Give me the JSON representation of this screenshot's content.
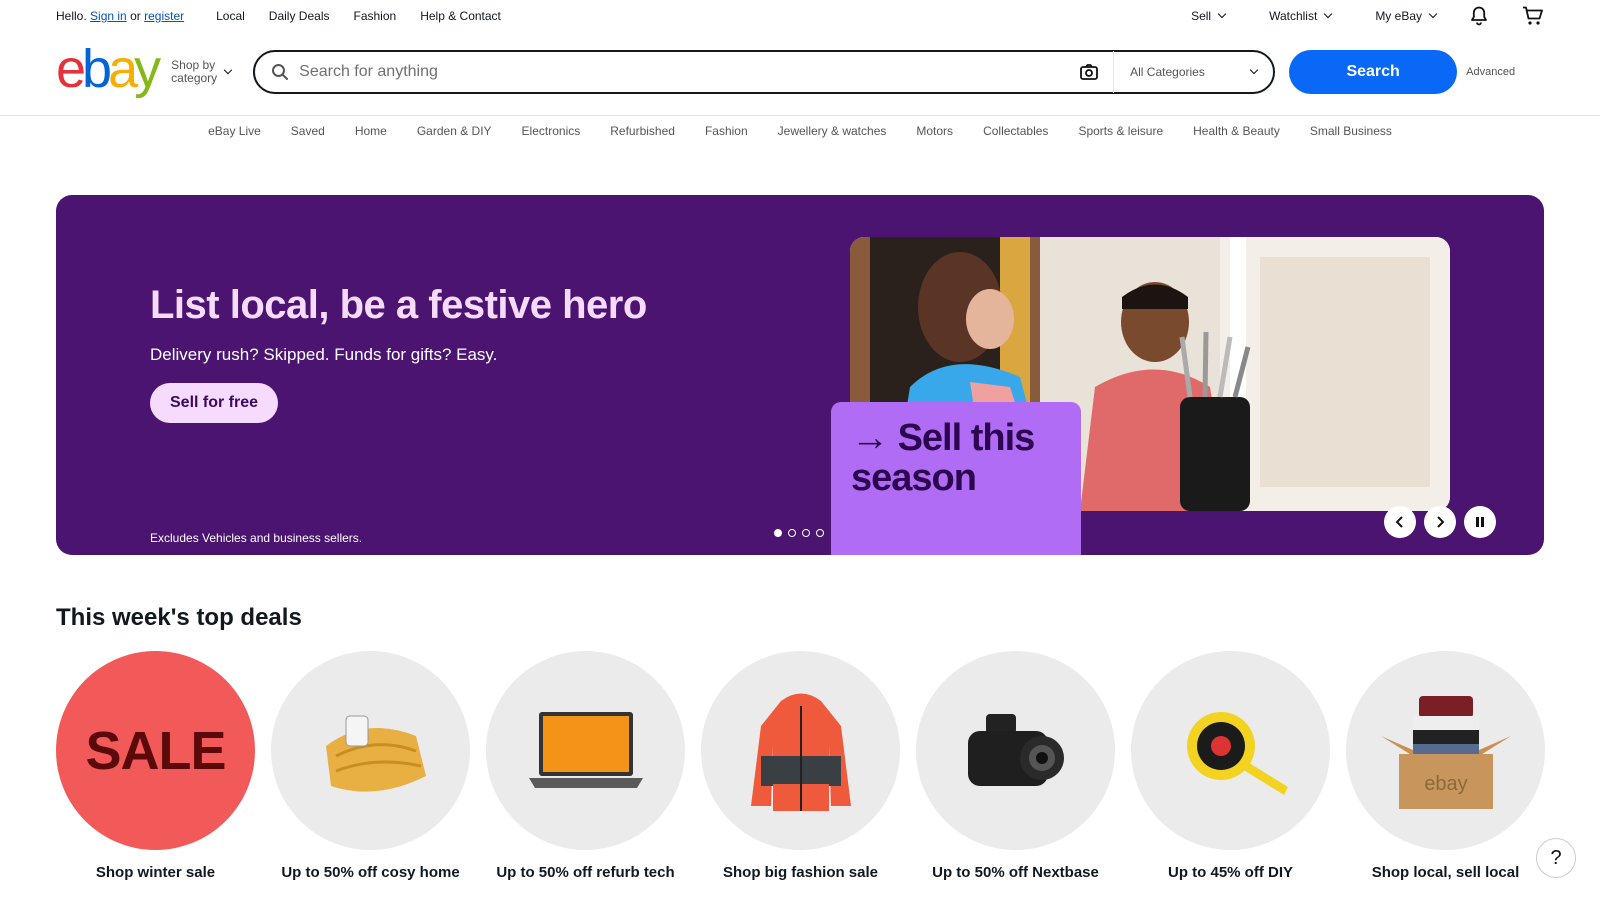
{
  "topbar": {
    "greeting_prefix": "Hello.",
    "sign_in": "Sign in",
    "or": "or",
    "register": "register",
    "links": [
      "Local",
      "Daily Deals",
      "Fashion",
      "Help & Contact"
    ],
    "right": [
      "Sell",
      "Watchlist",
      "My eBay"
    ]
  },
  "header": {
    "logo": {
      "e": "e",
      "b": "b",
      "a": "a",
      "y": "y"
    },
    "shop_by_category": "Shop by category",
    "search_placeholder": "Search for anything",
    "category_select": "All Categories",
    "search_button": "Search",
    "advanced": "Advanced"
  },
  "catnav": [
    "eBay Live",
    "Saved",
    "Home",
    "Garden & DIY",
    "Electronics",
    "Refurbished",
    "Fashion",
    "Jewellery & watches",
    "Motors",
    "Collectables",
    "Sports & leisure",
    "Health & Beauty",
    "Small Business"
  ],
  "hero": {
    "title": "List local, be a festive hero",
    "subtitle": "Delivery rush? Skipped. Funds for gifts? Easy.",
    "cta": "Sell for free",
    "exclusion": "Excludes Vehicles and business sellers.",
    "tag_arrow": "→",
    "tag_line1": "Sell this",
    "tag_line2": "season",
    "slide_count": 4,
    "active_slide": 1
  },
  "deals": {
    "title": "This week's top deals",
    "items": [
      {
        "label": "Shop winter sale",
        "image_text": "SALE"
      },
      {
        "label": "Up to 50% off cosy home"
      },
      {
        "label": "Up to 50% off refurb tech"
      },
      {
        "label": "Shop big fashion sale"
      },
      {
        "label": "Up to 50% off Nextbase"
      },
      {
        "label": "Up to 45% off DIY"
      },
      {
        "label": "Shop local, sell local",
        "image_text": "ebay"
      }
    ]
  },
  "help": "?",
  "colors": {
    "brand_blue": "#0968f6",
    "hero_bg": "#4a1470",
    "hero_accent": "#f6dbff",
    "tag_bg": "#b06cf4",
    "sale_red": "#f25a5a"
  }
}
